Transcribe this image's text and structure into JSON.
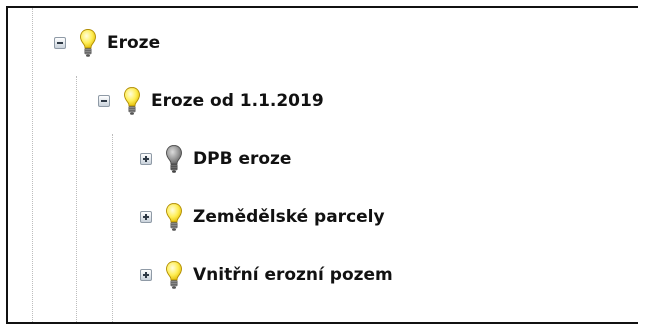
{
  "tree": {
    "nodes": [
      {
        "label": "Eroze",
        "expanded": true,
        "visible": true,
        "icon": "lightbulb-icon"
      },
      {
        "label": "Eroze od 1.1.2019",
        "expanded": true,
        "visible": true,
        "icon": "lightbulb-icon"
      },
      {
        "label": "DPB eroze",
        "expanded": false,
        "visible": false,
        "icon": "lightbulb-off-icon"
      },
      {
        "label": "Zemědělské parcely",
        "expanded": false,
        "visible": true,
        "icon": "lightbulb-icon"
      },
      {
        "label": "Vnitřní erozní pozem",
        "expanded": false,
        "visible": true,
        "icon": "lightbulb-icon"
      }
    ]
  },
  "colors": {
    "bulb_on": "#ffee55",
    "bulb_off": "#8c8c8c",
    "frame_border": "#111111",
    "guide_line": "#bdbdbd"
  }
}
